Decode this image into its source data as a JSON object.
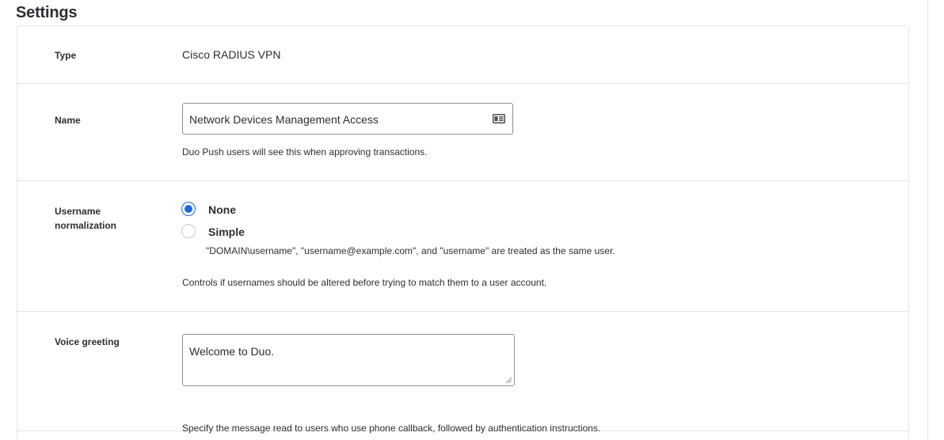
{
  "page": {
    "title": "Settings"
  },
  "type_field": {
    "label": "Type",
    "value": "Cisco RADIUS VPN"
  },
  "name_field": {
    "label": "Name",
    "value": "Network Devices Management Access",
    "icon": "contact-card-icon",
    "help": "Duo Push users will see this when approving transactions."
  },
  "username_normalization": {
    "label": "Username normalization",
    "selected": "None",
    "options": [
      {
        "label": "None",
        "checked": true,
        "description": ""
      },
      {
        "label": "Simple",
        "checked": false,
        "description": "\"DOMAIN\\username\", \"username@example.com\", and \"username\" are treated as the same user."
      }
    ],
    "help": "Controls if usernames should be altered before trying to match them to a user account."
  },
  "voice_greeting": {
    "label": "Voice greeting",
    "value": "Welcome to Duo.",
    "help": "Specify the message read to users who use phone callback, followed by authentication instructions."
  },
  "colors": {
    "accent": "#1f6ad9",
    "border": "#e1e4e8",
    "text": "#2b2f33"
  }
}
